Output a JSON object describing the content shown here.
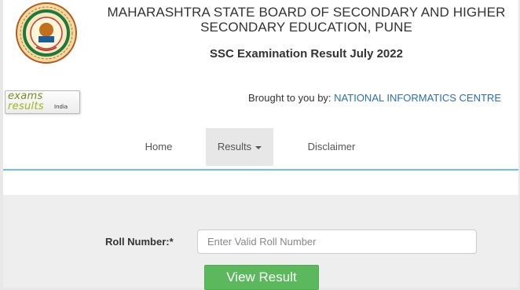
{
  "header": {
    "board_title": "MAHARASHTRA STATE BOARD OF SECONDARY AND HIGHER SECONDARY EDUCATION, PUNE",
    "exam_title": "SSC Examination Result July 2022",
    "logo_icon": "board-seal-icon",
    "partner_badge": {
      "line1": "exams",
      "line2": "results",
      "line3": "India"
    },
    "brought_by_label": "Brought to you by:",
    "brought_by_org": "NATIONAL INFORMATICS CENTRE"
  },
  "nav": {
    "home": "Home",
    "results": "Results",
    "disclaimer": "Disclaimer",
    "active": "Results",
    "rule_color": "#6ec1e4"
  },
  "form": {
    "roll_label": "Roll Number:*",
    "roll_placeholder": "Enter Valid Roll Number",
    "roll_value": "",
    "submit_label": "View Result",
    "submit_color": "#5cb85c"
  }
}
